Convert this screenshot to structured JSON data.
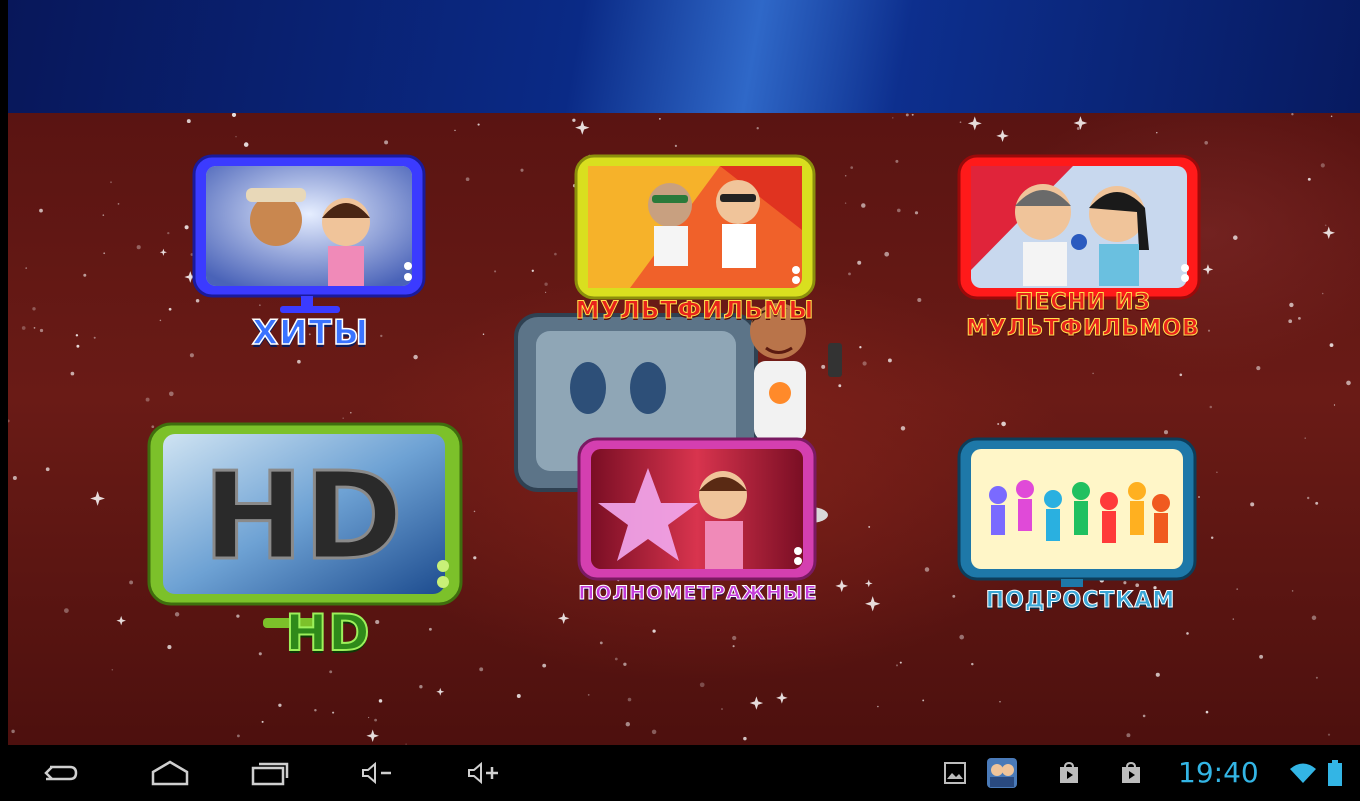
{
  "tiles": [
    {
      "key": "hits",
      "label": "ХИТЫ"
    },
    {
      "key": "cartoons",
      "label": "МУЛЬТФИЛЬМЫ"
    },
    {
      "key": "songs",
      "label_line1": "ПЕСНИ ИЗ",
      "label_line2": "МУЛЬТФИЛЬМОВ"
    },
    {
      "key": "hd",
      "label": "HD",
      "screen_text": "HD"
    },
    {
      "key": "feature",
      "label": "ПОЛНОМЕТРАЖНЫЕ"
    },
    {
      "key": "teens",
      "label": "ПОДРОСТКАМ"
    }
  ],
  "status_bar": {
    "time": "19:40",
    "accent_color": "#33b5e5"
  },
  "nav_bar": {
    "buttons": [
      "back-icon",
      "home-icon",
      "recent-apps-icon",
      "volume-down-icon",
      "volume-up-icon"
    ],
    "notifications": [
      "gallery-icon",
      "app-thumbnail-icon",
      "play-store-icon",
      "play-store-icon"
    ]
  },
  "colors": {
    "background": "#5a1412",
    "top_bar": "#0a2a86",
    "hits_frame": "#3b3bff",
    "cartoons_frame": "#d9df1f",
    "songs_frame": "#ff1a1a",
    "hd_frame": "#7cc12a",
    "feature_frame": "#d43fb0",
    "teens_frame": "#1e78a8"
  }
}
